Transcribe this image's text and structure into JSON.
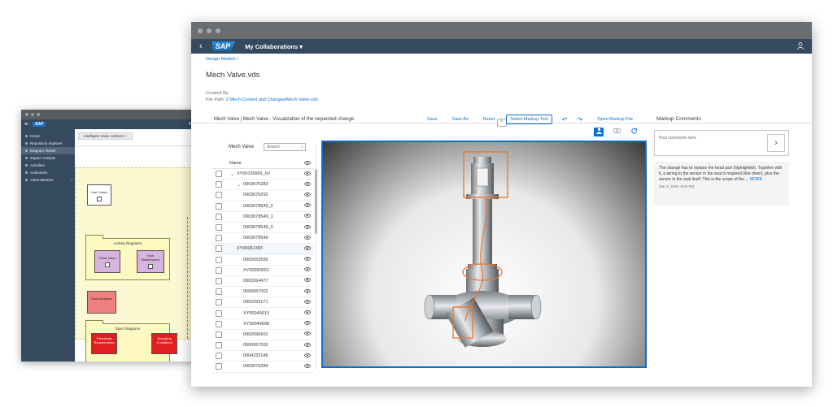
{
  "back_window": {
    "logo": "SAP",
    "shell_right": "Requ",
    "nav_items": [
      {
        "label": "Home"
      },
      {
        "label": "Repository Explorer"
      },
      {
        "label": "Diagram Viewer",
        "active": true
      },
      {
        "label": "Impact Analysis"
      },
      {
        "label": "Activities"
      },
      {
        "label": "Customize"
      },
      {
        "label": "Administration",
        "has_chevron": true
      }
    ],
    "tab_label": "Intelligent Valve Artifacts ×",
    "diagram": {
      "use_cases": "Use Cases",
      "activity_diagrams": "Activity Diagrams",
      "clean_valve": "Clean Valve",
      "seal_maintenance": "Seal Maintenance",
      "spec_diagrams": "Spec Diagrams",
      "functional_requirements": "Functional Requirements",
      "operating_conditions": "Operating Conditions",
      "node_analysis": "Node Analysis"
    }
  },
  "front_window": {
    "shell": {
      "back": "‹",
      "logo": "SAP",
      "title": "My Collaborations ▾",
      "user_icon": "person-icon"
    },
    "header": {
      "breadcrumb": "Design Models /",
      "title": "Mech Valve.vds",
      "created_by_label": "Created By:",
      "file_path_label": "File Path:",
      "file_path": "2 Mech Context and Changes/Mech Valve.vds",
      "collapse": "^"
    },
    "toolbar": {
      "title": "Mech Valve | Mech Valve - Visualization of the requested change",
      "save": "Save",
      "save_as": "Save As",
      "reset": "Reset",
      "select_markup_tool": "Select Markup Tool",
      "undo": "↶",
      "redo": "↷",
      "open_markup_file": "Open Markup File"
    },
    "view_icons": [
      "person-icon",
      "camera-icon",
      "refresh-icon"
    ],
    "tree": {
      "title": "Mech Valve",
      "search_placeholder": "Search",
      "search_icon": "⌕",
      "column_name": "Name",
      "eye": "👁",
      "rows": [
        {
          "label": "XY00195901_Ini",
          "level": 0,
          "expanded": true
        },
        {
          "label": "0903076283",
          "level": 1,
          "expanded": true
        },
        {
          "label": "0903076292",
          "level": 2
        },
        {
          "label": "0903078549_2",
          "level": 2
        },
        {
          "label": "0903078549_1",
          "level": 2
        },
        {
          "label": "0903078549_0",
          "level": 2
        },
        {
          "label": "0903078549",
          "level": 2
        },
        {
          "label": "XY00061383",
          "level": 1,
          "selected": true
        },
        {
          "label": "0902052550",
          "level": 2
        },
        {
          "label": "XY00050021",
          "level": 2
        },
        {
          "label": "0902264477",
          "level": 2
        },
        {
          "label": "0560557002",
          "level": 2
        },
        {
          "label": "0902293171",
          "level": 2
        },
        {
          "label": "XY00049913",
          "level": 2
        },
        {
          "label": "XY00049698",
          "level": 2
        },
        {
          "label": "0902096601",
          "level": 2
        },
        {
          "label": "0560557002",
          "level": 2
        },
        {
          "label": "0904232146",
          "level": 2
        },
        {
          "label": "0903076289",
          "level": 2
        }
      ]
    },
    "markup_comments": {
      "heading": "Markup Comments",
      "placeholder": "Post comments here",
      "send": "›",
      "comment_text": "The change has to replace the head part (highlighted). Together with it, a wiring to the sensor in the seal is required (line down), plus the sensor in the seal itself. This is the scope of the ...",
      "more": "MORE",
      "date": "Mar 3, 2020, 9:50 PM"
    },
    "colors": {
      "shell": "#354a5f",
      "accent": "#0a6ed1",
      "markup": "#e8772e"
    }
  }
}
